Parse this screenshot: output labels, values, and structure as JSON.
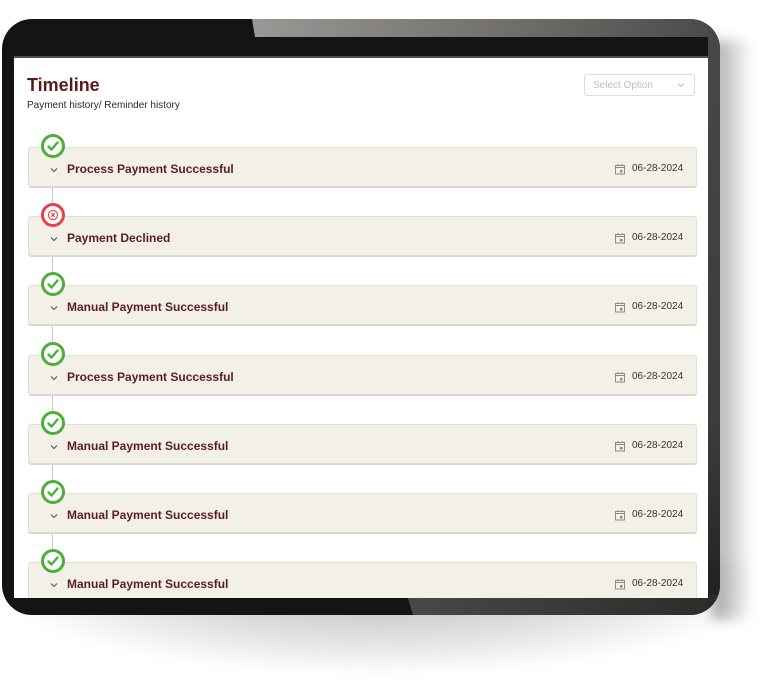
{
  "header": {
    "title": "Timeline",
    "subtitle": "Payment history/ Reminder history"
  },
  "filter": {
    "placeholder": "Select Option",
    "icon": "chevron-down-icon"
  },
  "colors": {
    "title": "#5c1a1a",
    "success": "#4caf3a",
    "failure": "#e5414b",
    "card_background": "#f3f0e8"
  },
  "timeline": {
    "items": [
      {
        "title": "Process Payment Successful",
        "date": "06-28-2024",
        "status": "success",
        "status_icon": "check-circle-icon",
        "date_icon": "calendar-icon"
      },
      {
        "title": "Payment Declined",
        "date": "06-28-2024",
        "status": "failure",
        "status_icon": "x-circle-icon",
        "date_icon": "calendar-icon"
      },
      {
        "title": "Manual Payment Successful",
        "date": "06-28-2024",
        "status": "success",
        "status_icon": "check-circle-icon",
        "date_icon": "calendar-icon"
      },
      {
        "title": "Process Payment Successful",
        "date": "06-28-2024",
        "status": "success",
        "status_icon": "check-circle-icon",
        "date_icon": "calendar-icon"
      },
      {
        "title": "Manual Payment Successful",
        "date": "06-28-2024",
        "status": "success",
        "status_icon": "check-circle-icon",
        "date_icon": "calendar-icon"
      },
      {
        "title": "Manual Payment Successful",
        "date": "06-28-2024",
        "status": "success",
        "status_icon": "check-circle-icon",
        "date_icon": "calendar-icon"
      },
      {
        "title": "Manual Payment Successful",
        "date": "06-28-2024",
        "status": "success",
        "status_icon": "check-circle-icon",
        "date_icon": "calendar-icon"
      }
    ]
  }
}
